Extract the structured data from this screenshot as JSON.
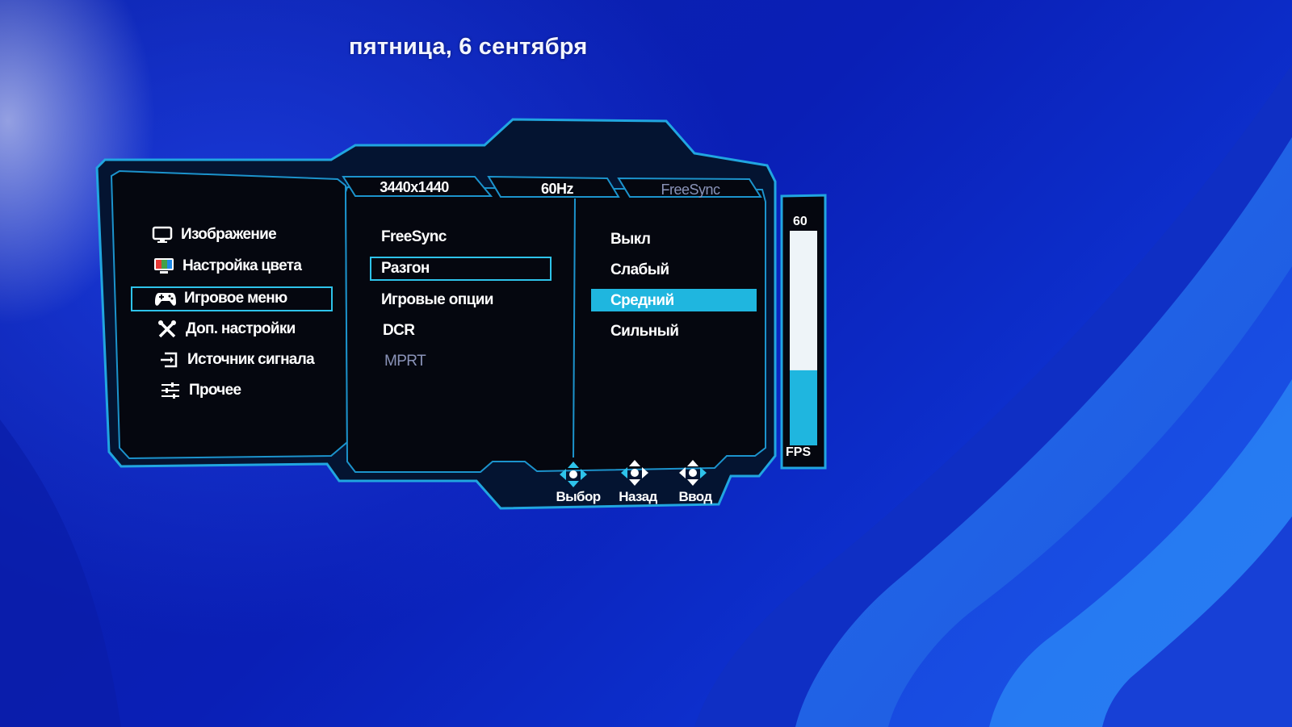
{
  "date": "пятница, 6 сентября",
  "status_tabs": [
    {
      "label": "3440x1440",
      "active": true
    },
    {
      "label": "60Hz",
      "active": true
    },
    {
      "label": "FreeSync",
      "active": false
    }
  ],
  "main_menu": [
    {
      "label": "Изображение",
      "icon": "monitor-icon",
      "selected": false
    },
    {
      "label": "Настройка цвета",
      "icon": "color-palette-icon",
      "selected": false
    },
    {
      "label": "Игровое меню",
      "icon": "gamepad-icon",
      "selected": true
    },
    {
      "label": "Доп. настройки",
      "icon": "tools-icon",
      "selected": false
    },
    {
      "label": "Источник сигнала",
      "icon": "input-source-icon",
      "selected": false
    },
    {
      "label": "Прочее",
      "icon": "sliders-icon",
      "selected": false
    }
  ],
  "sub_menu": [
    {
      "label": "FreeSync",
      "enabled": true,
      "selected": false
    },
    {
      "label": "Разгон",
      "enabled": true,
      "selected": true
    },
    {
      "label": "Игровые опции",
      "enabled": true,
      "selected": false
    },
    {
      "label": "DCR",
      "enabled": true,
      "selected": false
    },
    {
      "label": "MPRT",
      "enabled": false,
      "selected": false
    }
  ],
  "options": [
    {
      "label": "Выкл",
      "selected": false
    },
    {
      "label": "Слабый",
      "selected": false
    },
    {
      "label": "Средний",
      "selected": true
    },
    {
      "label": "Сильный",
      "selected": false
    }
  ],
  "fps_meter": {
    "value_label": "60",
    "unit_label": "FPS",
    "level": 0.35
  },
  "nav_hints": [
    {
      "label": "Выбор",
      "icon": "dpad-select-icon"
    },
    {
      "label": "Назад",
      "icon": "dpad-back-icon"
    },
    {
      "label": "Ввод",
      "icon": "dpad-enter-icon"
    }
  ],
  "colors": {
    "accent": "#2ec3ea",
    "panel": "#05070f",
    "frame": "#1a9bd6",
    "wallpaper": "#0a1fb0"
  }
}
